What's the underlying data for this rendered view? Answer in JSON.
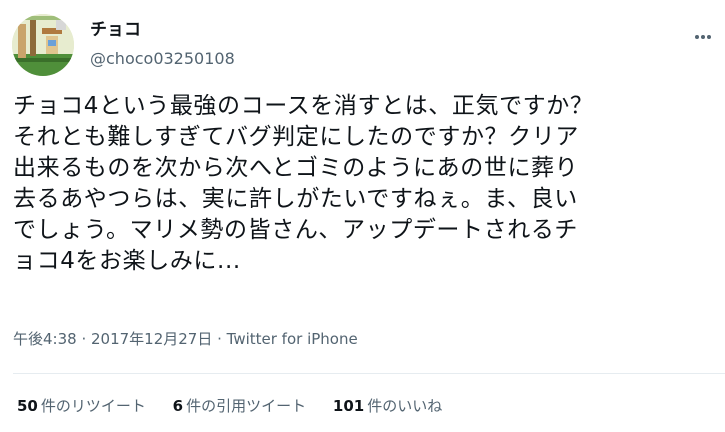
{
  "user": {
    "display_name": "チョコ",
    "handle": "@choco03250108"
  },
  "tweet": {
    "lines": [
      "チョコ4という最強のコースを消すとは、正気ですか？",
      "それとも難しすぎてバグ判定にしたのですか？クリア",
      "出来るものを次から次へとゴミのようにあの世に葬り",
      "去るあやつらは、実に許しがたいですねぇ。ま、良い",
      "でしょう。マリメ勢の皆さん、アップデートされるチ",
      "ョコ4をお楽しみに..."
    ],
    "meta": "午後4:38 · 2017年12月27日 · Twitter for iPhone"
  },
  "stats": {
    "retweets_count": "50",
    "retweets_label": "件のリツイート",
    "quotes_count": "6",
    "quotes_label": "件の引用ツイート",
    "likes_count": "101",
    "likes_label": "件のいいね"
  },
  "icons": {
    "more": "more-horizontal-icon"
  }
}
